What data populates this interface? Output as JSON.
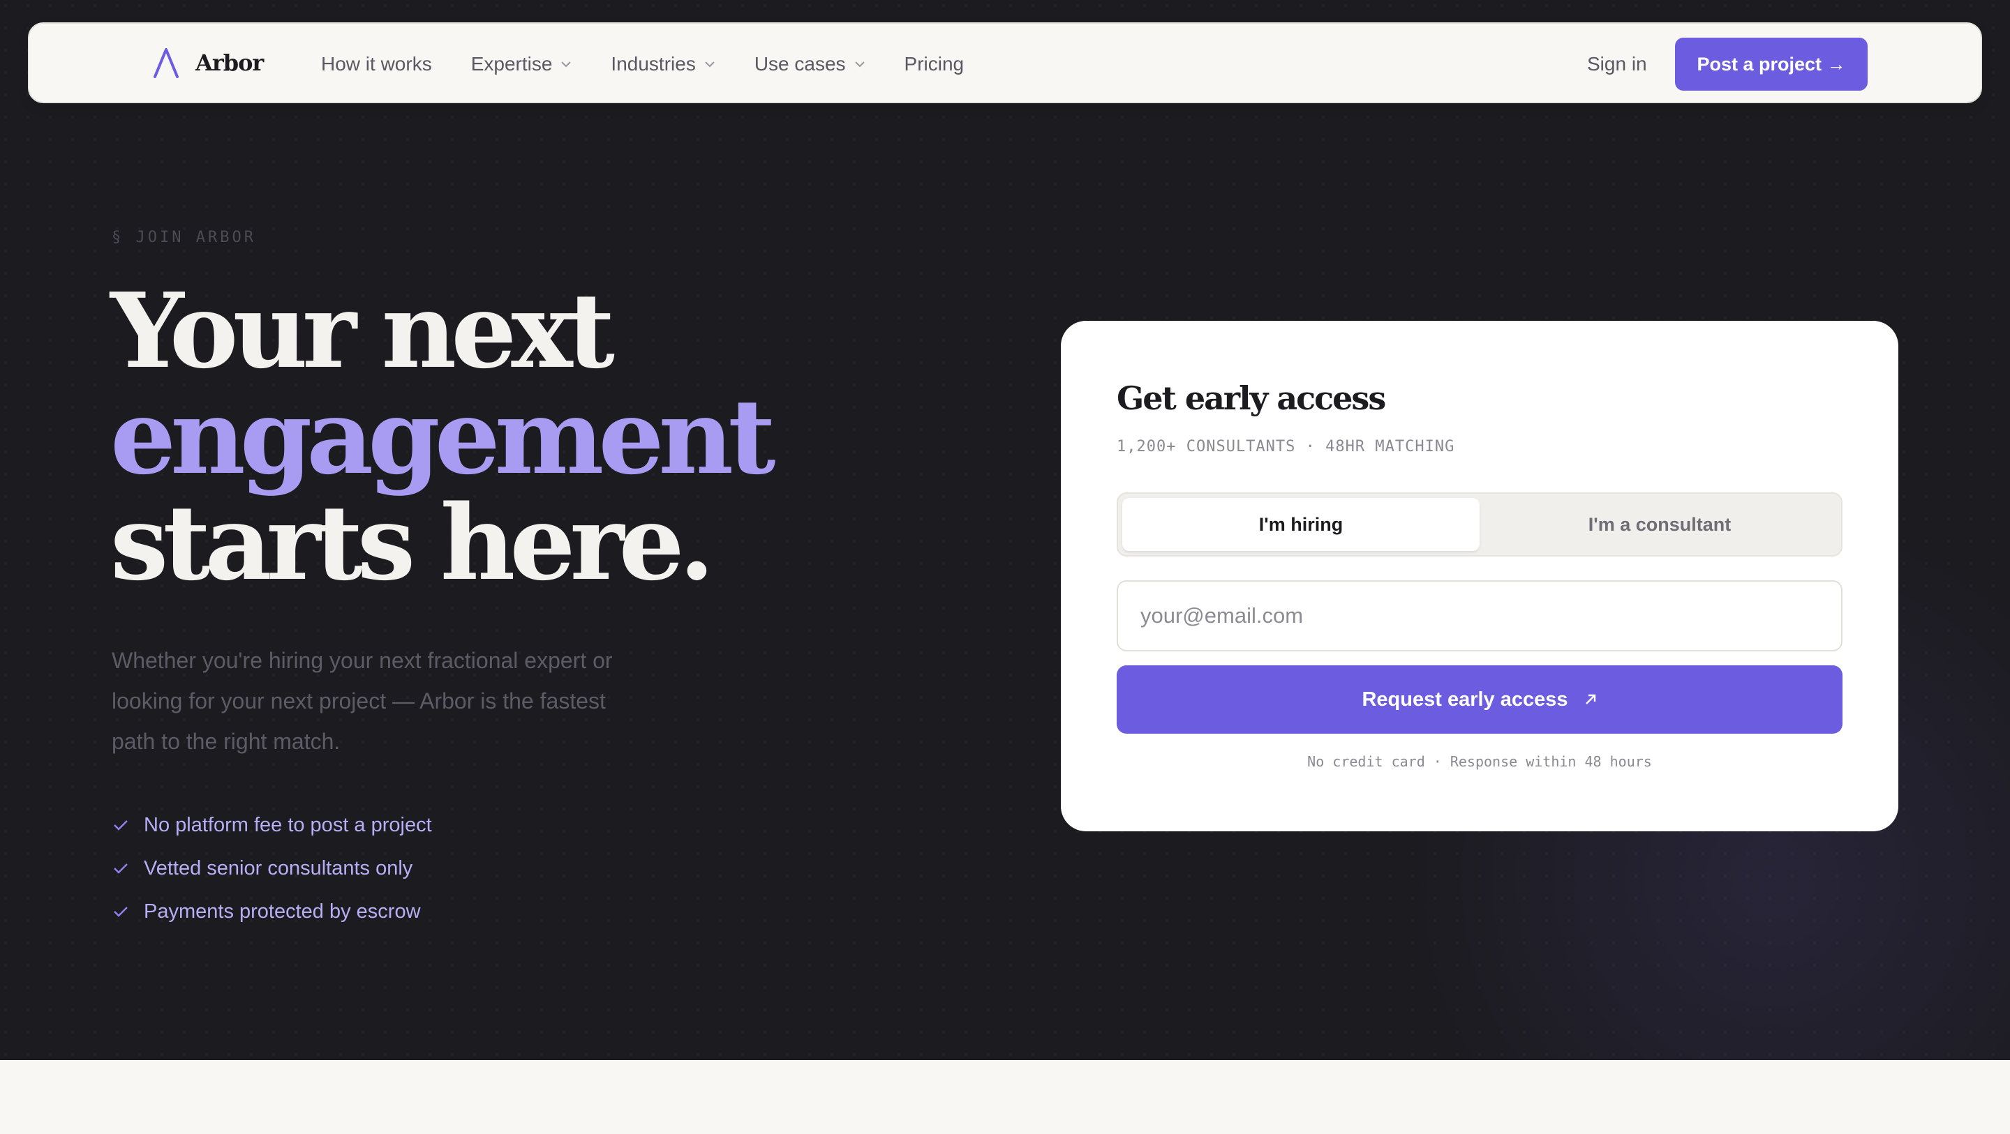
{
  "brand": {
    "name": "Arbor",
    "logo_icon": "arbor-a-icon",
    "accent_color": "#6b5ce0",
    "highlight_color": "#a79cf2"
  },
  "nav": {
    "links": [
      {
        "label": "How it works",
        "has_dropdown": false
      },
      {
        "label": "Expertise",
        "has_dropdown": true
      },
      {
        "label": "Industries",
        "has_dropdown": true
      },
      {
        "label": "Use cases",
        "has_dropdown": true
      },
      {
        "label": "Pricing",
        "has_dropdown": false
      }
    ],
    "sign_in": "Sign in",
    "cta": "Post a project →"
  },
  "hero": {
    "eyebrow": "§ JOIN ARBOR",
    "headline_line1": "Your next",
    "headline_line2": "engagement",
    "headline_line3": "starts here.",
    "lede": "Whether you're hiring your next fractional expert or looking for your next project — Arbor is the fastest path to the right match.",
    "benefits": [
      "No platform fee to post a project",
      "Vetted senior consultants only",
      "Payments protected by escrow"
    ]
  },
  "card": {
    "title": "Get early access",
    "subtitle": "1,200+ CONSULTANTS · 48HR MATCHING",
    "toggle": {
      "options": [
        "I'm hiring",
        "I'm a consultant"
      ],
      "selected": "I'm hiring"
    },
    "email_placeholder": "your@email.com",
    "email_value": "",
    "submit": "Request early access",
    "footnote": "No credit card · Response within 48 hours"
  }
}
